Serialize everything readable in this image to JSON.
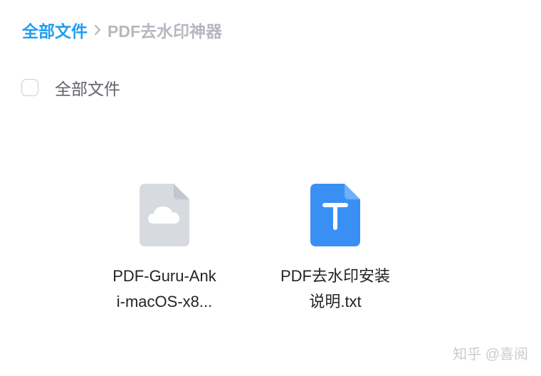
{
  "breadcrumb": {
    "root": "全部文件",
    "current": "PDF去水印神器"
  },
  "selection": {
    "select_all_label": "全部文件"
  },
  "files": [
    {
      "name_line1": "PDF-Guru-Ank",
      "name_line2": "i-macOS-x8...",
      "icon": "cloud-file-icon"
    },
    {
      "name_line1": "PDF去水印安装",
      "name_line2": "说明.txt",
      "icon": "text-file-icon"
    }
  ],
  "watermark": {
    "text": "知乎 @喜阅"
  },
  "colors": {
    "accent": "#1e9df2",
    "breadcrumb_inactive": "#b5b8bf",
    "txt_icon": "#3a8ff5",
    "generic_icon": "#d7dade"
  }
}
